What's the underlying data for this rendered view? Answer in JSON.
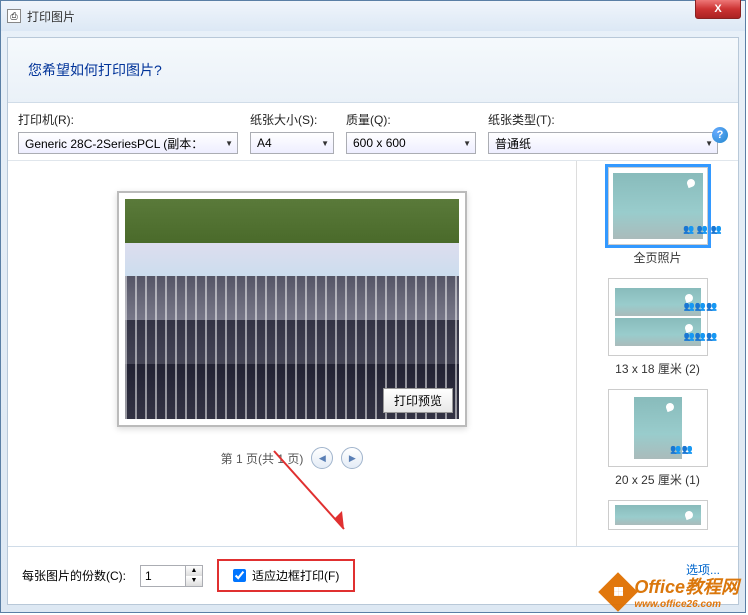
{
  "window": {
    "title": "打印图片",
    "close_glyph": "X"
  },
  "header": {
    "question": "您希望如何打印图片?"
  },
  "controls": {
    "printer_label": "打印机(R):",
    "printer_value": "Generic 28C-2SeriesPCL (副本：",
    "paper_label": "纸张大小(S):",
    "paper_value": "A4",
    "quality_label": "质量(Q):",
    "quality_value": "600 x 600",
    "type_label": "纸张类型(T):",
    "type_value": "普通纸",
    "help_glyph": "?"
  },
  "preview": {
    "button_label": "打印预览"
  },
  "pager": {
    "text": "第 1 页(共 1 页)",
    "prev_glyph": "◀",
    "next_glyph": "▶"
  },
  "layouts": [
    {
      "label": "全页照片"
    },
    {
      "label": "13 x 18 厘米 (2)"
    },
    {
      "label": "20 x 25 厘米 (1)"
    },
    {
      "label": ""
    }
  ],
  "footer": {
    "copies_label": "每张图片的份数(C):",
    "copies_value": "1",
    "fit_label": "适应边框打印(F)",
    "options_label": "选项...",
    "spin_up": "▲",
    "spin_down": "▼"
  },
  "watermark": {
    "brand": "Office教程网",
    "sub": "www.office26.com"
  }
}
